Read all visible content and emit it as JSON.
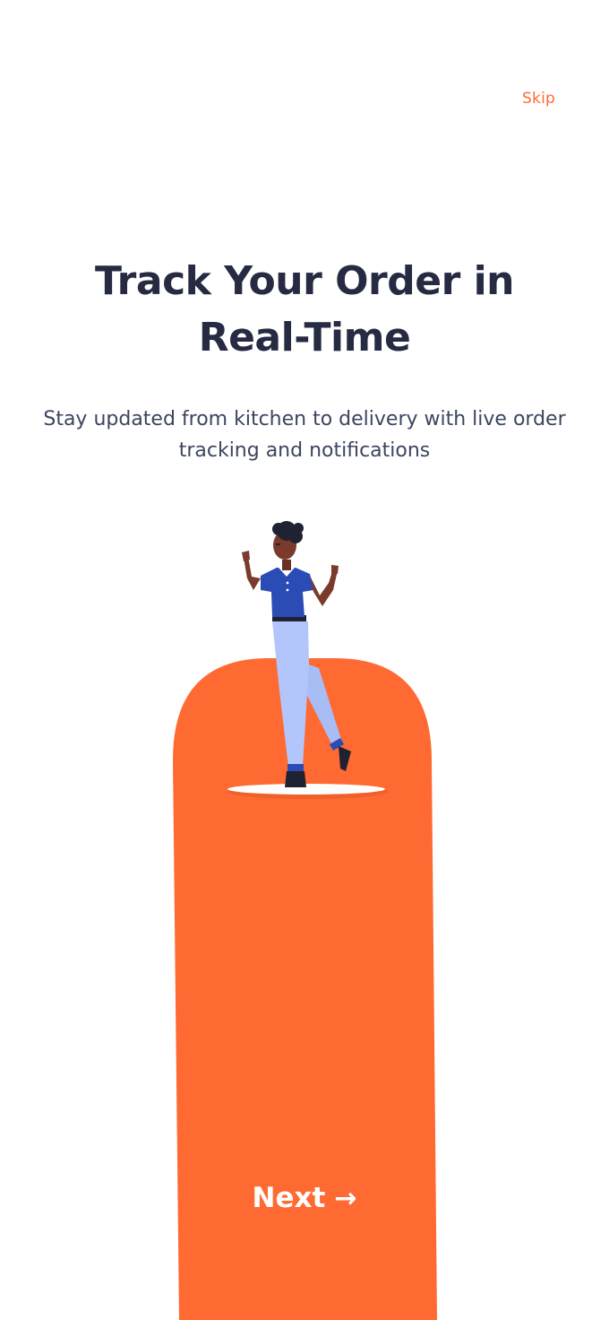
{
  "theme": {
    "accent": "#ff6a33",
    "title_color": "#262a42",
    "subtitle_color": "#3d4560"
  },
  "header": {
    "skip_label": "Skip"
  },
  "onboarding": {
    "title": "Track Your Order in Real-Time",
    "subtitle": "Stay updated from kitchen to delivery with live order tracking and notifications"
  },
  "illustration": {
    "icon": "person-celebrating-illustration"
  },
  "footer": {
    "next_label": "Next",
    "next_icon": "arrow-right-icon",
    "next_arrow_glyph": "→"
  }
}
